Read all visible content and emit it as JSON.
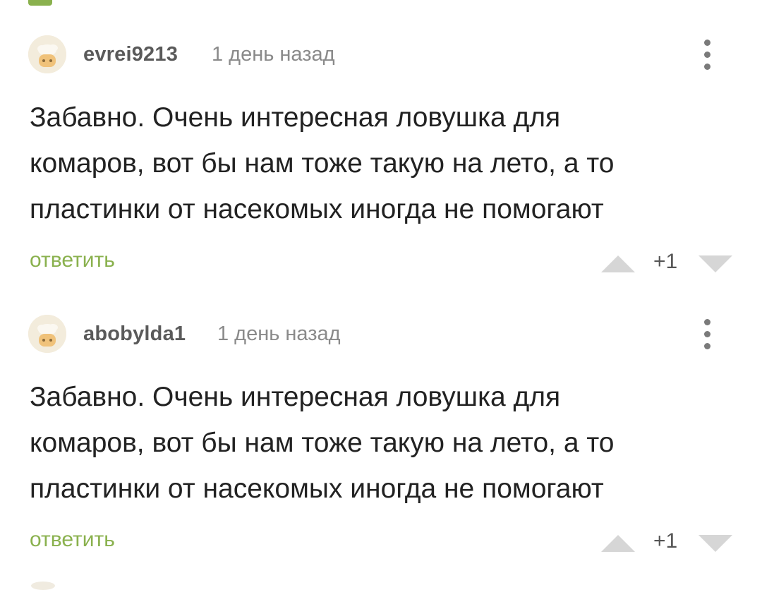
{
  "colors": {
    "accent": "#8ab14e",
    "text": "#222222",
    "meta": "#8a8a8a",
    "vote_arrow": "#d6d6d6",
    "avatar_bg": "#f3ecdc"
  },
  "icons": {
    "avatar": "default-avatar-icon",
    "more": "more-vertical-icon",
    "upvote": "triangle-up-icon",
    "downvote": "triangle-down-icon"
  },
  "comments": [
    {
      "username": "evrei9213",
      "time": "1 день назад",
      "lines": [
        "Забавно. Очень интересная ловушка для",
        "комаров, вот бы нам тоже такую на лето, а то",
        "пластинки от насекомых иногда не помогают"
      ],
      "reply_label": "ответить",
      "rating": "+1"
    },
    {
      "username": "abobylda1",
      "time": "1 день назад",
      "lines": [
        "Забавно. Очень интересная ловушка для",
        "комаров, вот бы нам тоже такую на лето, а то",
        "пластинки от насекомых иногда не помогают"
      ],
      "reply_label": "ответить",
      "rating": "+1"
    }
  ]
}
